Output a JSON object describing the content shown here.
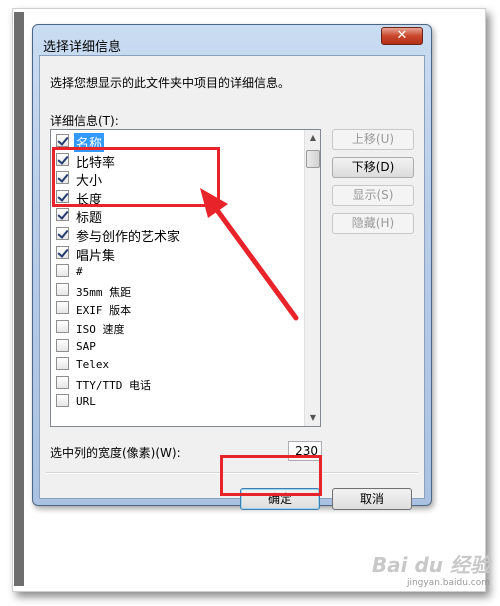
{
  "window": {
    "title": "选择详细信息",
    "close_symbol": "✕"
  },
  "instruction": "选择您想显示的此文件夹中项目的详细信息。",
  "details_label": "详细信息(T):",
  "items": [
    {
      "label": "名称",
      "checked": true,
      "selected": true,
      "mono": false
    },
    {
      "label": "比特率",
      "checked": true,
      "selected": false,
      "mono": false
    },
    {
      "label": "大小",
      "checked": true,
      "selected": false,
      "mono": false
    },
    {
      "label": "长度",
      "checked": true,
      "selected": false,
      "mono": false
    },
    {
      "label": "标题",
      "checked": true,
      "selected": false,
      "mono": false
    },
    {
      "label": "参与创作的艺术家",
      "checked": true,
      "selected": false,
      "mono": false
    },
    {
      "label": "唱片集",
      "checked": true,
      "selected": false,
      "mono": false
    },
    {
      "label": "#",
      "checked": false,
      "selected": false,
      "mono": true
    },
    {
      "label": "35mm 焦距",
      "checked": false,
      "selected": false,
      "mono": true
    },
    {
      "label": "EXIF 版本",
      "checked": false,
      "selected": false,
      "mono": true
    },
    {
      "label": "ISO 速度",
      "checked": false,
      "selected": false,
      "mono": true
    },
    {
      "label": "SAP",
      "checked": false,
      "selected": false,
      "mono": true
    },
    {
      "label": "Telex",
      "checked": false,
      "selected": false,
      "mono": true
    },
    {
      "label": "TTY/TTD 电话",
      "checked": false,
      "selected": false,
      "mono": true
    },
    {
      "label": "URL",
      "checked": false,
      "selected": false,
      "mono": true
    }
  ],
  "side_buttons": {
    "move_up": "上移(U)",
    "move_down": "下移(D)",
    "show": "显示(S)",
    "hide": "隐藏(H)"
  },
  "width_label": "选中列的宽度(像素)(W):",
  "width_value": "230",
  "buttons": {
    "ok": "确定",
    "cancel": "取消"
  },
  "watermark": {
    "brand": "Bai du 经验",
    "url": "jingyan.baidu.com"
  },
  "colors": {
    "highlight_red": "#e8232a",
    "selection_blue": "#3399ff"
  }
}
